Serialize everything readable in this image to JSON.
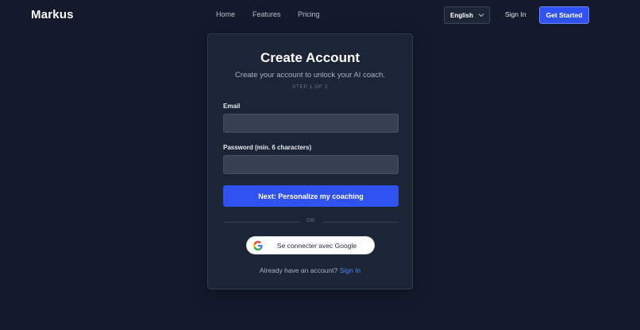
{
  "brand": {
    "name": "Markus"
  },
  "nav": {
    "home": "Home",
    "features": "Features",
    "pricing": "Pricing"
  },
  "header": {
    "language": "English",
    "sign_in": "Sign In",
    "get_started": "Get Started"
  },
  "card": {
    "title": "Create Account",
    "subtitle": "Create your account to unlock your AI coach.",
    "step": "STEP 1 OF 2",
    "email_label": "Email",
    "email_value": "",
    "password_label": "Password (min. 6 characters)",
    "password_value": "",
    "primary_button": "Next: Personalize my coaching",
    "divider": "OR",
    "google_button": "Se connecter avec Google",
    "footer_prompt": "Already have an account?",
    "footer_link": "Sign In"
  },
  "colors": {
    "background": "#121a2c",
    "card": "#1b2536",
    "accent": "#2f52f0",
    "link": "#4f86ff"
  },
  "icons": {
    "language_chevron": "chevron-down-icon",
    "google": "google-logo-icon"
  }
}
